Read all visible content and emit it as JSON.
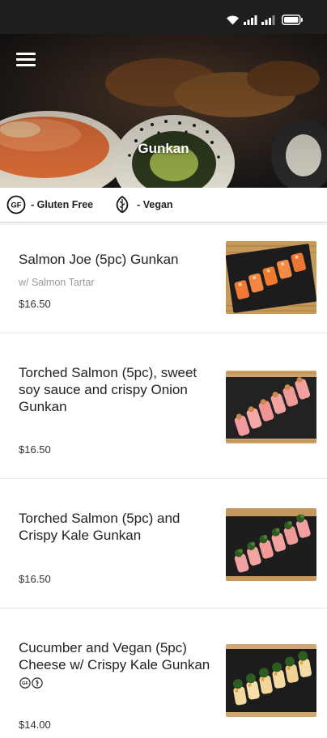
{
  "header": {
    "title": "Gunkan"
  },
  "legend": [
    {
      "icon": "gluten-free-icon",
      "badge": "GF",
      "label": "- Gluten Free"
    },
    {
      "icon": "vegan-leaf-icon",
      "label": "- Vegan"
    }
  ],
  "items": [
    {
      "name": "Salmon Joe (5pc) Gunkan",
      "description": "w/ Salmon Tartar",
      "price": "$16.50"
    },
    {
      "name": "Torched Salmon (5pc), sweet soy sauce and crispy Onion Gunkan",
      "description": "",
      "price": "$16.50"
    },
    {
      "name": "Torched Salmon (5pc) and Crispy Kale Gunkan",
      "description": "",
      "price": "$16.50"
    },
    {
      "name": "Cucumber and Vegan (5pc) Cheese w/ Crispy Kale Gunkan",
      "description": "",
      "price": "$14.00",
      "badges": [
        "gluten-free-icon",
        "vegan-leaf-icon"
      ]
    }
  ],
  "colors": {
    "status_bar": "#1e1e1e",
    "text": "#222222",
    "muted": "#9a9a9a"
  }
}
